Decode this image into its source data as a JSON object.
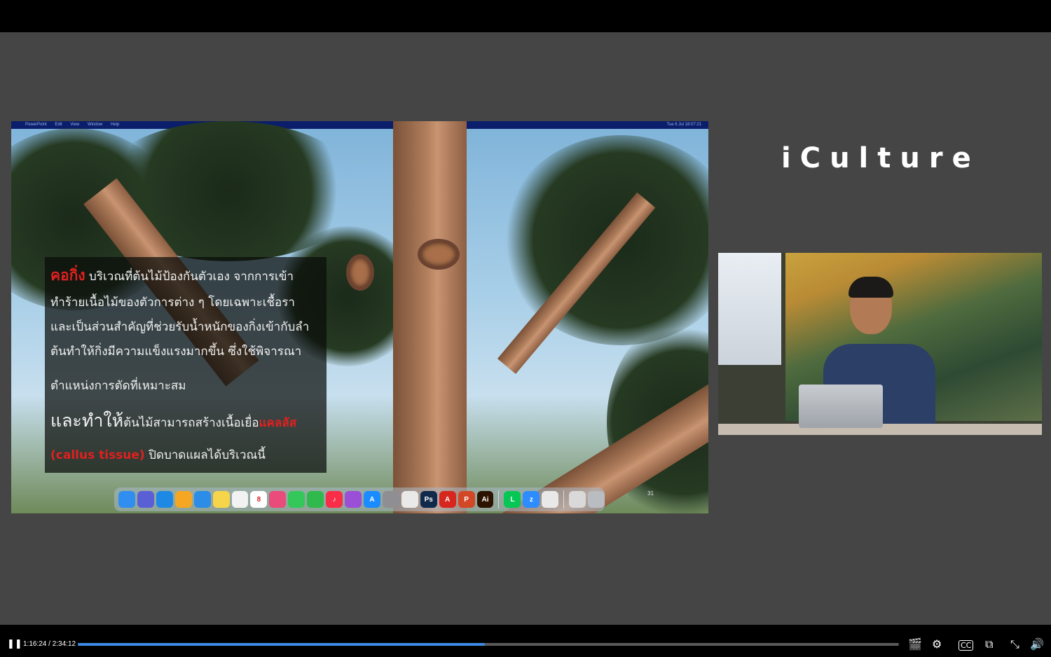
{
  "player": {
    "play_pause_icon": "pause-icon",
    "current_time": "1:16:24",
    "duration": "2:34:12",
    "time_text": "1:16:24 / 2:34:12",
    "progress_fraction": 0.496,
    "accent": "#3d8be6"
  },
  "brand": "iCulture",
  "slide": {
    "menubar_left": [
      "PowerPoint",
      "Edit",
      "View",
      "Window",
      "Help"
    ],
    "menubar_right": "Tue 6 Jul 18:07:21",
    "lines": [
      {
        "red": "คอกิ่ง",
        "text": " บริเวณที่ต้นไม้ป้องกันตัวเอง จากการเข้า"
      },
      {
        "text": "ทำร้ายเนื้อไม้ของตัวการต่าง ๆ โดยเฉพาะเชื้อรา"
      },
      {
        "text": "และเป็นส่วนสำคัญที่ช่วยรับน้ำหนักของกิ่งเข้ากับลำ"
      },
      {
        "text": "ต้นทำให้กิ่งมีความแข็งแรงมากขึ้น ซึ่งใช้พิจารณา"
      },
      {
        "text": "ตำแหน่งการตัดที่เหมาะสม"
      },
      {
        "big": "และทำให้",
        "text": "ต้นไม้สามารถสร้างเนื้อเยื่อ",
        "red": "แคลลัส"
      },
      {
        "red": "(callus tissue)",
        "text": " ปิดบาดแผลได้บริเวณนี้"
      }
    ],
    "page_number": "31"
  },
  "dock_icons": [
    {
      "name": "finder-icon",
      "color": "#2f8ef0",
      "label": ""
    },
    {
      "name": "launchpad-icon",
      "color": "#5a5fd6",
      "label": ""
    },
    {
      "name": "safari-icon",
      "color": "#1e88e5",
      "label": ""
    },
    {
      "name": "apps-grid-icon",
      "color": "#f5a623",
      "label": ""
    },
    {
      "name": "mail-icon",
      "color": "#2b8de8",
      "label": ""
    },
    {
      "name": "notes-icon",
      "color": "#f7d54a",
      "label": ""
    },
    {
      "name": "reminders-icon",
      "color": "#f2f2f2",
      "label": ""
    },
    {
      "name": "calendar-icon",
      "color": "#ffffff",
      "label": "8"
    },
    {
      "name": "photos-icon",
      "color": "#e94b7a",
      "label": ""
    },
    {
      "name": "messages-icon",
      "color": "#34c759",
      "label": ""
    },
    {
      "name": "facetime-icon",
      "color": "#30b94d",
      "label": ""
    },
    {
      "name": "music-icon",
      "color": "#fa2d48",
      "label": "♪"
    },
    {
      "name": "podcasts-icon",
      "color": "#9b4fd6",
      "label": ""
    },
    {
      "name": "app-store-icon",
      "color": "#1a8cff",
      "label": "A"
    },
    {
      "name": "system-preferences-icon",
      "color": "#8e8e93",
      "label": ""
    },
    {
      "name": "preview-icon",
      "color": "#e9e9e9",
      "label": ""
    },
    {
      "name": "photoshop-icon",
      "color": "#0f2a4a",
      "label": "Ps"
    },
    {
      "name": "acrobat-icon",
      "color": "#d7261e",
      "label": "A"
    },
    {
      "name": "powerpoint-icon",
      "color": "#d24726",
      "label": "P"
    },
    {
      "name": "illustrator-icon",
      "color": "#2b1300",
      "label": "Ai"
    },
    {
      "name": "line-icon",
      "color": "#06c755",
      "label": "L"
    },
    {
      "name": "zoom-icon",
      "color": "#2d8cff",
      "label": "z"
    },
    {
      "name": "chrome-icon",
      "color": "#e8e8e8",
      "label": ""
    },
    {
      "name": "downloads-icon",
      "color": "#d9d9d9",
      "label": ""
    },
    {
      "name": "trash-icon",
      "color": "#b9bcc1",
      "label": ""
    }
  ],
  "controls_icons": [
    "clapperboard-icon",
    "settings-icon",
    "captions-icon",
    "miniplayer-icon",
    "exit-fullscreen-icon",
    "volume-icon"
  ]
}
